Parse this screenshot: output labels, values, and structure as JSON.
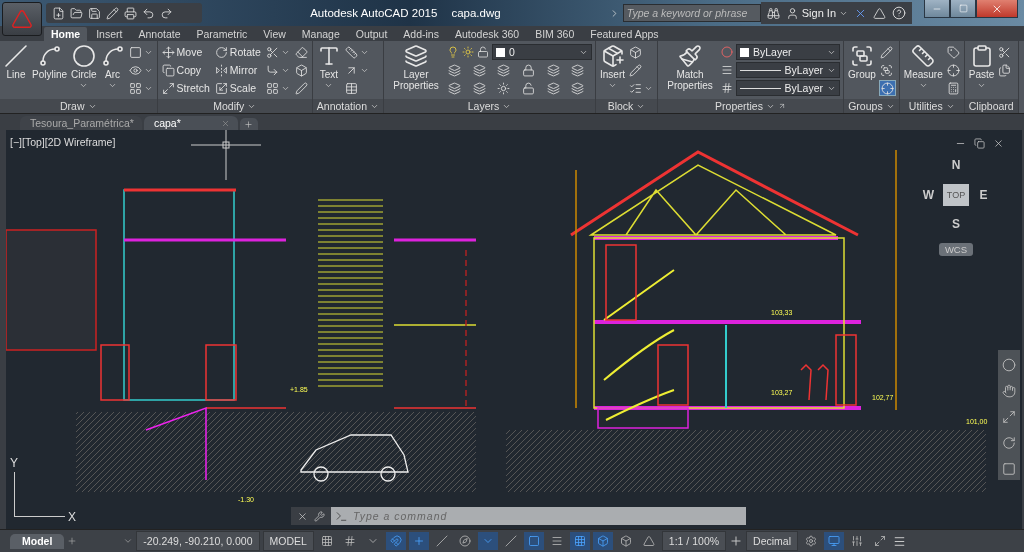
{
  "window": {
    "title": "Autodesk AutoCAD 2015",
    "file": "capa.dwg"
  },
  "search": {
    "placeholder": "Type a keyword or phrase"
  },
  "account": {
    "label": "Sign In"
  },
  "ribbon_tabs": [
    {
      "label": "Home",
      "selected": true
    },
    {
      "label": "Insert",
      "selected": false
    },
    {
      "label": "Annotate",
      "selected": false
    },
    {
      "label": "Parametric",
      "selected": false
    },
    {
      "label": "View",
      "selected": false
    },
    {
      "label": "Manage",
      "selected": false
    },
    {
      "label": "Output",
      "selected": false
    },
    {
      "label": "Add-ins",
      "selected": false
    },
    {
      "label": "Autodesk 360",
      "selected": false
    },
    {
      "label": "BIM 360",
      "selected": false
    },
    {
      "label": "Featured Apps",
      "selected": false
    }
  ],
  "panels": [
    {
      "title": "Draw",
      "menu": true,
      "large": [
        {
          "label": "Line",
          "dropdown": false
        },
        {
          "label": "Polyline",
          "dropdown": false
        },
        {
          "label": "Circle",
          "dropdown": true
        },
        {
          "label": "Arc",
          "dropdown": true
        }
      ],
      "small": [
        {
          "dropdown": true
        },
        {
          "dropdown": true
        },
        {
          "dropdown": true
        }
      ]
    },
    {
      "title": "Modify",
      "menu": true,
      "small": [
        {
          "label": "Move",
          "dropdown": false
        },
        {
          "label": "Rotate",
          "dropdown": false
        },
        {
          "dropdown": true
        },
        {
          "dropdown": false
        },
        {
          "label": "Copy",
          "dropdown": false
        },
        {
          "label": "Mirror",
          "dropdown": false
        },
        {
          "dropdown": true
        },
        {
          "dropdown": false
        },
        {
          "label": "Stretch",
          "dropdown": false
        },
        {
          "label": "Scale",
          "dropdown": false
        },
        {
          "dropdown": true
        },
        {
          "dropdown": false
        }
      ]
    },
    {
      "title": "Annotation",
      "menu": true,
      "large": [
        {
          "label": "Text",
          "dropdown": true
        }
      ],
      "small": [
        {
          "dropdown": true
        },
        {
          "dropdown": true
        },
        {
          "dropdown": false
        }
      ]
    },
    {
      "title": "Layers",
      "menu": true,
      "large": [
        {
          "label": "Layer Properties",
          "dropdown": false
        }
      ],
      "combos": [
        {
          "kind": "layer",
          "value": "0"
        }
      ],
      "small": [
        {
          "dropdown": false
        },
        {
          "dropdown": false
        },
        {
          "dropdown": false
        },
        {
          "dropdown": false
        },
        {
          "dropdown": false
        },
        {
          "dropdown": false
        },
        {
          "dropdown": false
        },
        {
          "dropdown": false
        },
        {
          "dropdown": false
        },
        {
          "dropdown": false
        },
        {
          "dropdown": false
        },
        {
          "dropdown": false
        }
      ]
    },
    {
      "title": "Block",
      "menu": true,
      "large": [
        {
          "label": "Insert",
          "dropdown": true
        }
      ],
      "small": [
        {
          "dropdown": false
        },
        {
          "dropdown": false
        },
        {
          "dropdown": true
        }
      ]
    },
    {
      "title": "Properties",
      "menu": true,
      "launcher": true,
      "large": [
        {
          "label": "Match Properties",
          "dropdown": false
        }
      ],
      "combos": [
        {
          "kind": "color",
          "value": "ByLayer"
        },
        {
          "kind": "linetype",
          "value": "ByLayer"
        },
        {
          "kind": "lineweight",
          "value": "ByLayer"
        }
      ]
    },
    {
      "title": "Groups",
      "menu": true,
      "large": [
        {
          "label": "Group",
          "dropdown": false
        }
      ],
      "small": [
        {
          "dropdown": false,
          "on": false
        },
        {
          "dropdown": false,
          "on": false
        },
        {
          "dropdown": false,
          "on": true
        }
      ]
    },
    {
      "title": "Utilities",
      "menu": true,
      "large": [
        {
          "label": "Measure",
          "dropdown": true
        }
      ],
      "small": [
        {
          "dropdown": false
        },
        {
          "dropdown": false
        },
        {
          "dropdown": false
        }
      ]
    },
    {
      "title": "Clipboard",
      "menu": false,
      "large": [
        {
          "label": "Paste",
          "dropdown": true
        }
      ],
      "small": [
        {
          "dropdown": false
        },
        {
          "dropdown": false
        }
      ]
    }
  ],
  "file_tabs": [
    {
      "label": "Tesoura_Paramétrica*",
      "selected": false
    },
    {
      "label": "capa*",
      "selected": true
    }
  ],
  "viewport": {
    "label": "[−][Top][2D Wireframe]",
    "compass": {
      "north": "N",
      "west": "W",
      "east": "E",
      "south": "S",
      "face": "TOP",
      "ucs": "WCS"
    },
    "ucs_axes": {
      "x": "X",
      "y": "Y"
    },
    "levels": [
      {
        "text": "+1.85"
      },
      {
        "text": "-1.30"
      },
      {
        "text": "103,33"
      },
      {
        "text": "103,27"
      },
      {
        "text": "102,77"
      },
      {
        "text": "101,00"
      }
    ]
  },
  "command_line": {
    "placeholder": "Type a command"
  },
  "layout_tabs": [
    {
      "label": "Model",
      "selected": true
    }
  ],
  "status_bar": {
    "coordinates": "-20.249, -90.210, 0.000",
    "space": "MODEL",
    "toggles": [
      {
        "on": false
      },
      {
        "on": false
      },
      {
        "on": false
      },
      {
        "on": true
      },
      {
        "on": true
      },
      {
        "on": false
      },
      {
        "on": false
      },
      {
        "on": true
      },
      {
        "on": false
      },
      {
        "on": true
      },
      {
        "on": false
      },
      {
        "on": true
      },
      {
        "on": true
      },
      {
        "on": false
      },
      {
        "on": false
      }
    ],
    "annotation_scale": "1:1 / 100%",
    "units": "Decimal",
    "tail_toggles": [
      {
        "on": false
      },
      {
        "on": true
      },
      {
        "on": false
      },
      {
        "on": false
      }
    ]
  }
}
